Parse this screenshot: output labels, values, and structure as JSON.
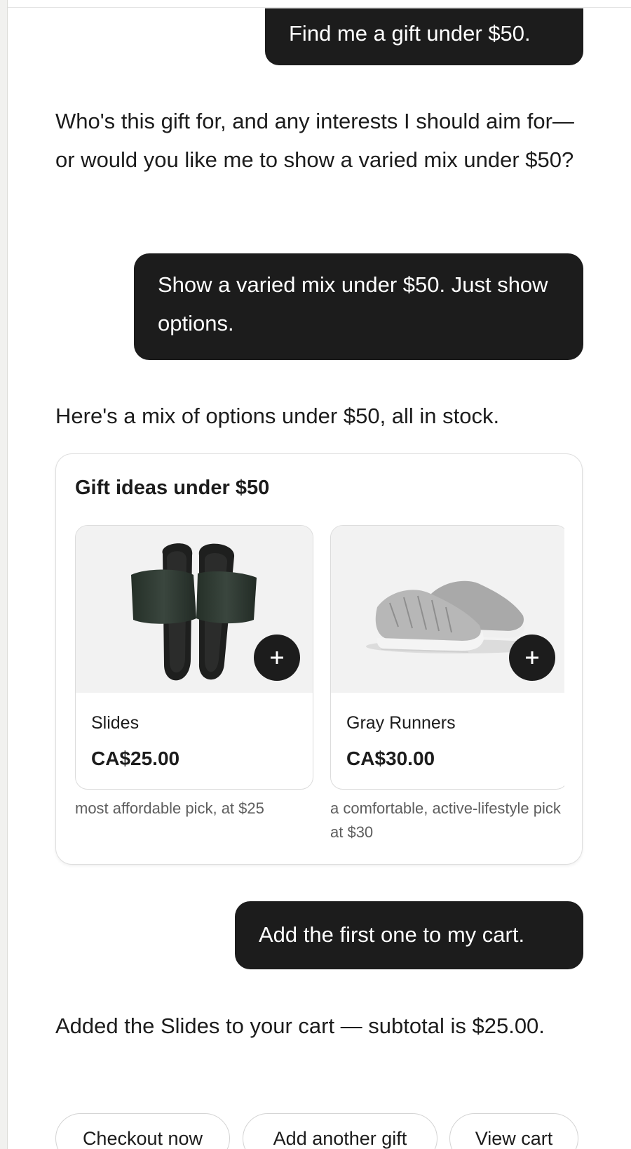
{
  "conversation": {
    "user_message_1": "Find me a gift under $50.",
    "assistant_message_1": "Who's this gift for, and any interests I should aim for—or would you like me to show a varied mix under $50?",
    "user_message_2": "Show a varied mix under $50. Just show options.",
    "assistant_message_2": "Here's a mix of options under $50, all in stock.",
    "user_message_3": "Add the first one to my cart.",
    "assistant_message_3": "Added the Slides to your cart — subtotal is $25.00."
  },
  "gift_card": {
    "title": "Gift ideas under $50",
    "products": [
      {
        "name": "Slides",
        "price": "CA$25.00",
        "note": "most affordable pick, at $25",
        "image_icon": "black-slides-image",
        "add_icon": "plus-icon"
      },
      {
        "name": "Gray Runners",
        "price": "CA$30.00",
        "note": "a comfortable, active-lifestyle pick at $30",
        "image_icon": "gray-sneakers-image",
        "add_icon": "plus-icon"
      }
    ]
  },
  "quick_actions": [
    "Checkout now",
    "Add another gift",
    "View cart"
  ],
  "colors": {
    "user_bubble": "#1c1c1c",
    "user_text": "#ffffff",
    "text": "#1c1c1c",
    "muted_text": "#5e5e5e",
    "card_border": "#dedede",
    "image_background": "#f2f2f2"
  }
}
